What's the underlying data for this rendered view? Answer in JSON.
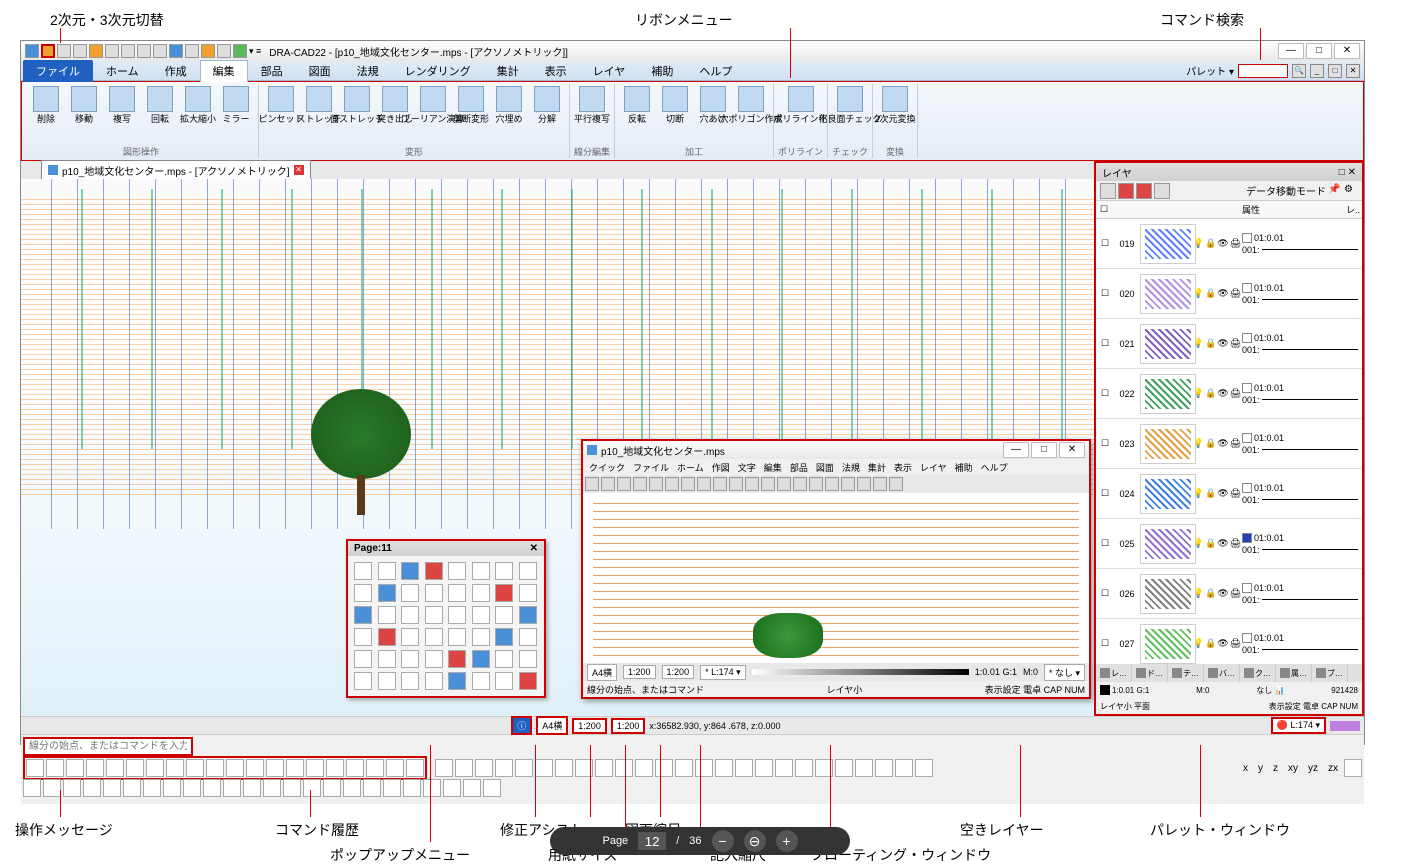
{
  "annotations": {
    "dim_toggle": "2次元・3次元切替",
    "ribbon_menu": "リボンメニュー",
    "command_search": "コマンド検索",
    "op_message": "操作メッセージ",
    "command_history": "コマンド履歴",
    "popup_menu": "ポップアップメニュー",
    "assist": "修正アシスト",
    "paper_size": "用紙サイズ",
    "drawing_scale": "図面縮尺",
    "input_scale": "記入縮尺",
    "floating_window": "フローティング・ウィンドウ",
    "empty_layer": "空きレイヤー",
    "palette_window": "パレット・ウィンドウ"
  },
  "titlebar": {
    "text": "DRA-CAD22 - [p10_地域文化センター.mps - [アクソノメトリック]]"
  },
  "window_controls": {
    "min": "—",
    "max": "□",
    "close": "✕"
  },
  "ribbon_tabs": [
    "ファイル",
    "ホーム",
    "作成",
    "編集",
    "部品",
    "図面",
    "法規",
    "レンダリング",
    "集計",
    "表示",
    "レイヤ",
    "補助",
    "ヘルプ"
  ],
  "ribbon_right": {
    "palette": "パレット ▾"
  },
  "ribbon_groups": [
    {
      "label": "図形操作",
      "items": [
        "削除",
        "移動",
        "複写",
        "回転",
        "拡大縮小",
        "ミラー"
      ]
    },
    {
      "label": "変形",
      "items": [
        "ピンセット",
        "ストレッチ",
        "面ストレッチ",
        "突き出し",
        "ブーリアン演算",
        "剪断変形",
        "穴埋め",
        "分解"
      ]
    },
    {
      "label": "線分編集",
      "items": [
        "平行複写"
      ]
    },
    {
      "label": "加工",
      "items": [
        "反転",
        "切断",
        "穴あけ",
        "穴ポリゴン作成"
      ]
    },
    {
      "label": "ポリライン",
      "items": [
        "ポリライン化"
      ]
    },
    {
      "label": "チェック",
      "items": [
        "不良面チェック"
      ]
    },
    {
      "label": "変換",
      "items": [
        "2次元変換"
      ]
    }
  ],
  "doc_tab": {
    "label": "p10_地域文化センター.mps - [アクソノメトリック]",
    "close": "✕"
  },
  "popup": {
    "title": "Page:11",
    "close": "✕"
  },
  "floating": {
    "title": "p10_地域文化センター.mps",
    "menu": [
      "クイック",
      "ファイル",
      "ホーム",
      "作図",
      "文字",
      "編集",
      "部品",
      "図面",
      "法規",
      "集計",
      "表示",
      "レイヤ",
      "補助",
      "ヘルプ"
    ],
    "status": {
      "paper": "A4横",
      "scale1": "1:200",
      "scale2": "1:200",
      "layer_marker": "* L:174 ▾",
      "g": "1:0.01 G:1",
      "m": "M:0",
      "none": "* なし ▾",
      "msg": "線分の始点、またはコマンド",
      "layer_small": "レイヤ小",
      "disp": "表示設定 電卓 CAP NUM"
    }
  },
  "layer_panel": {
    "title": "レイヤ",
    "pin": "□ ✕",
    "mode": "データ移動モード",
    "header_attr": "属性",
    "header_l": "レ..",
    "rows": [
      {
        "num": "019",
        "code1": "01:0.01",
        "code2": "001:"
      },
      {
        "num": "020",
        "code1": "01:0.01",
        "code2": "001:"
      },
      {
        "num": "021",
        "code1": "01:0.01",
        "code2": "001:"
      },
      {
        "num": "022",
        "code1": "01:0.01",
        "code2": "001:"
      },
      {
        "num": "023",
        "code1": "01:0.01",
        "code2": "001:"
      },
      {
        "num": "024",
        "code1": "01:0.01",
        "code2": "001:"
      },
      {
        "num": "025",
        "code1": "01:0.01",
        "code2": "001:"
      },
      {
        "num": "026",
        "code1": "01:0.01",
        "code2": "001:"
      },
      {
        "num": "027",
        "code1": "01:0.01",
        "code2": "001:"
      }
    ],
    "tabs": [
      "レ…",
      "ド…",
      "テ…",
      "バ…",
      "ク…",
      "属…",
      "ブ…"
    ],
    "status1_left": "1:0.01 G:1",
    "status1_m": "M:0",
    "status1_none": "なし",
    "status1_num": "921428",
    "status2_left": "レイヤ小 平面",
    "status2_right": "表示設定 電卓 CAP NUM"
  },
  "main_status": {
    "info_icon": "ⓘ",
    "paper": "A4横",
    "scale1": "1:200",
    "scale2": "1:200",
    "coords": "x:36582.930, y:864 .678, z:0.000",
    "layer": "L:174 ▾"
  },
  "bottom": {
    "msg_placeholder": "線分の始点、またはコマンドを入力",
    "axes": [
      "x",
      "y",
      "z",
      "xy",
      "yz",
      "zx"
    ]
  },
  "page_control": {
    "page_label": "Page",
    "current": "12",
    "sep": "/",
    "total": "36",
    "minus": "−",
    "zoom": "⊖",
    "plus": "+"
  }
}
